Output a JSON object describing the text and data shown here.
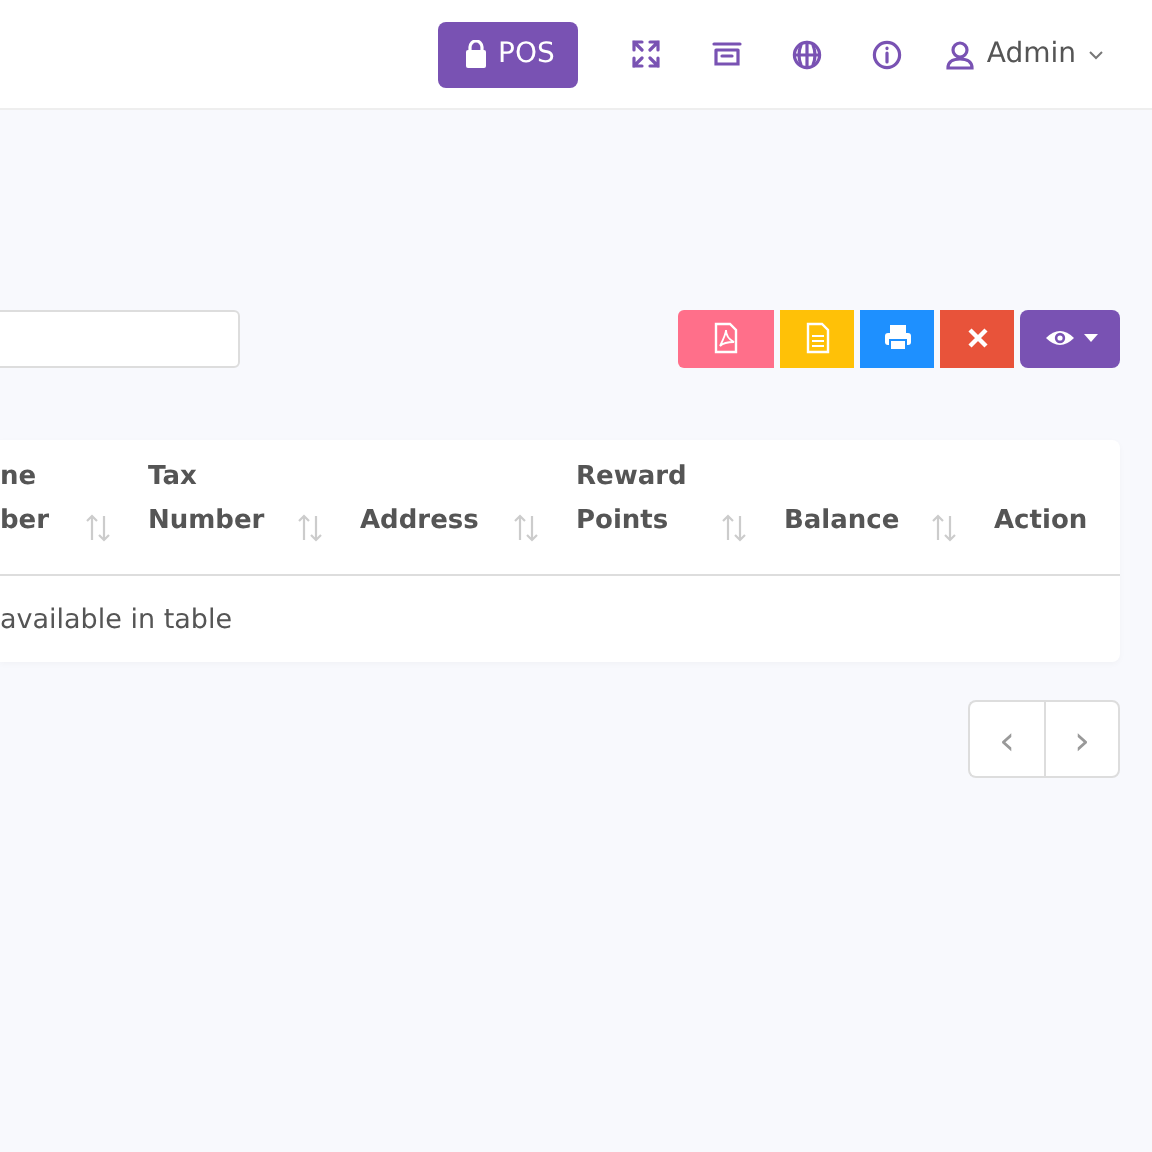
{
  "topbar": {
    "pos_button": "POS",
    "user": "Admin"
  },
  "toolbar": {
    "buttons": [
      {
        "kind": "pdf",
        "color": "#ff6f8a"
      },
      {
        "kind": "excel",
        "color": "#ffc107"
      },
      {
        "kind": "print",
        "color": "#1e90ff"
      },
      {
        "kind": "reset",
        "color": "#e8533a"
      },
      {
        "kind": "columns",
        "color": "#7952b3"
      }
    ]
  },
  "table": {
    "columns": [
      {
        "lines": [
          "ne",
          "ber"
        ],
        "sortable": true
      },
      {
        "lines": [
          "Tax",
          "Number"
        ],
        "sortable": true
      },
      {
        "lines": [
          "Address"
        ],
        "sortable": true
      },
      {
        "lines": [
          "Reward",
          "Points"
        ],
        "sortable": true
      },
      {
        "lines": [
          "Balance"
        ],
        "sortable": true
      },
      {
        "lines": [
          "Action"
        ],
        "sortable": false
      }
    ],
    "empty_message": "available in table"
  },
  "pagination": {
    "prev": "‹",
    "next": "›"
  }
}
